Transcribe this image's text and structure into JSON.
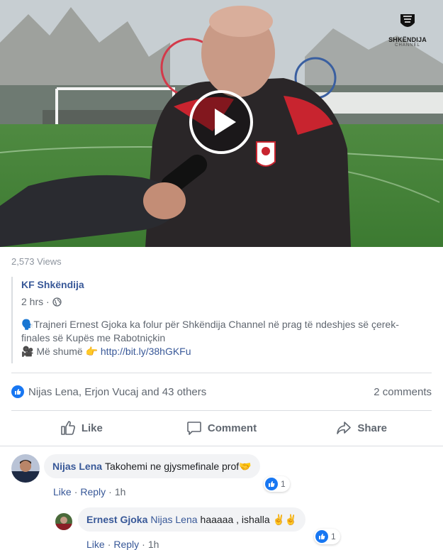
{
  "video": {
    "channel_logo_name": "SHKËNDIJA",
    "channel_logo_sub": "CHANNEL"
  },
  "post": {
    "views": "2,573 Views",
    "page_name": "KF Shkëndija",
    "time": "2 hrs ·",
    "text_line1": "🗣️Trajneri Ernest Gjoka ka folur për Shkëndija Channel në prag të ndeshjes së çerek-",
    "text_line2": "finales së Kupës me Rabotniçkin",
    "more_prefix": "🎥 Më shumë 👉 ",
    "link": "http://bit.ly/38hGKFu"
  },
  "reactions": {
    "names": "Nijas Lena, Erjon Vucaj and 43 others",
    "comments": "2 comments"
  },
  "actions": {
    "like": "Like",
    "comment": "Comment",
    "share": "Share"
  },
  "comments": [
    {
      "author": "Nijas Lena",
      "text": "Takohemi ne gjysmefinale prof🤝",
      "like": "Like",
      "reply": "Reply",
      "time": "1h",
      "reactions": "1"
    },
    {
      "author": "Ernest Gjoka",
      "mention": "Nijas Lena",
      "text": "haaaaa , ishalla ✌️✌️",
      "like": "Like",
      "reply": "Reply",
      "time": "1h",
      "reactions": "1"
    }
  ],
  "colors": {
    "link": "#385898",
    "brand_blue": "#1877f2",
    "club_red": "#d0202e"
  }
}
